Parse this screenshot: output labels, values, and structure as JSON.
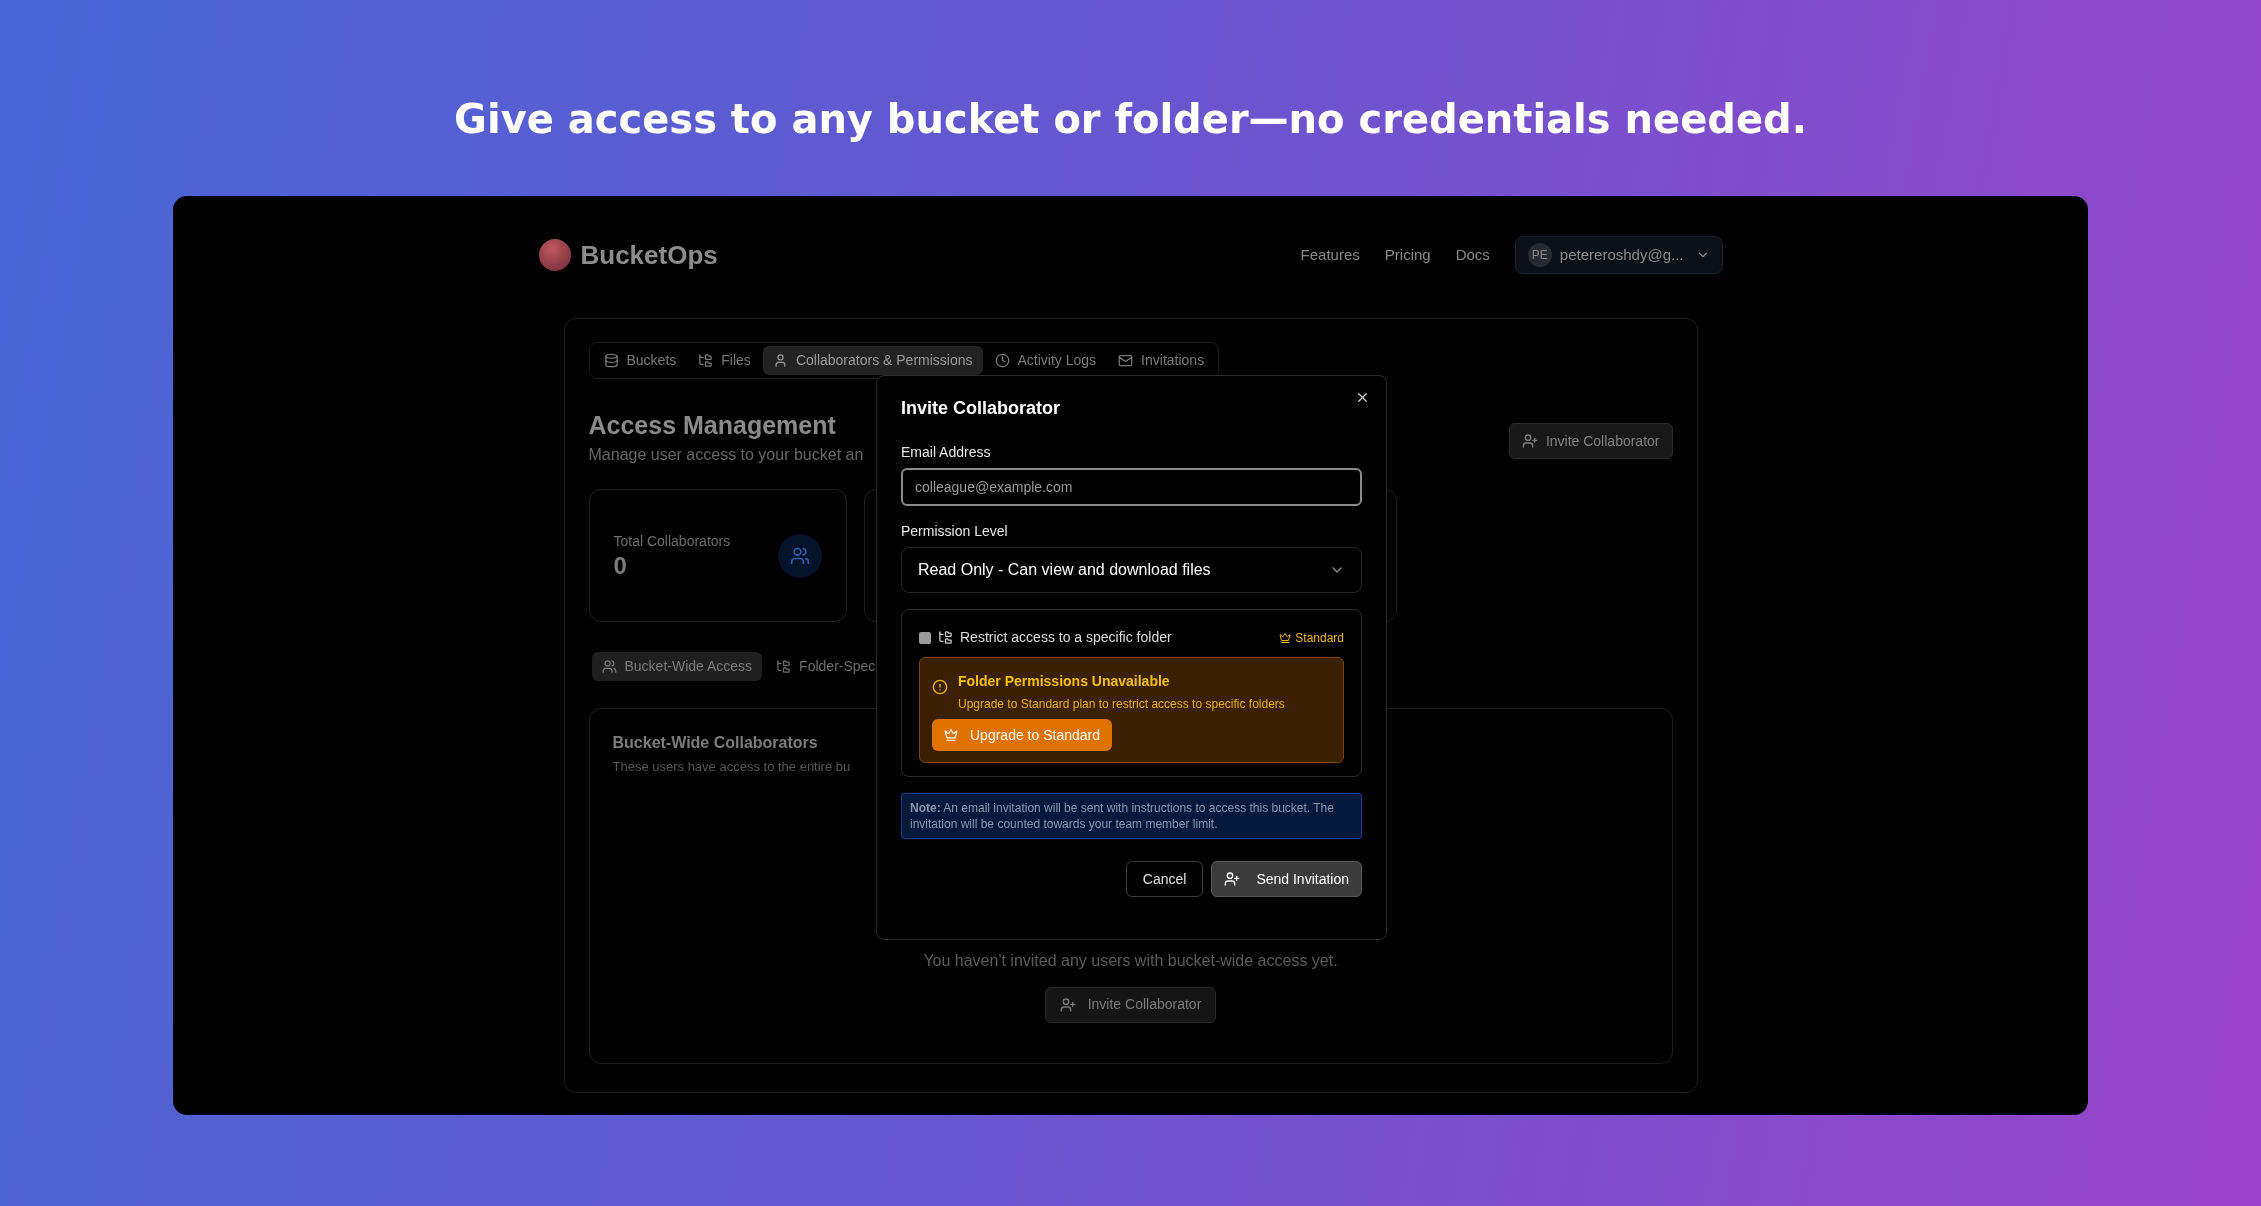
{
  "headline": "Give access to any bucket or folder—no credentials needed.",
  "brand": "BucketOps",
  "nav": [
    "Features",
    "Pricing",
    "Docs"
  ],
  "user": {
    "initials": "PE",
    "email": "petereroshdy@g..."
  },
  "tabs": [
    {
      "label": "Buckets",
      "selected": false
    },
    {
      "label": "Files",
      "selected": false
    },
    {
      "label": "Collaborators & Permissions",
      "selected": true
    },
    {
      "label": "Activity Logs",
      "selected": false
    },
    {
      "label": "Invitations",
      "selected": false
    }
  ],
  "page": {
    "title": "Access Management",
    "subtitle": "Manage user access to your bucket an",
    "invite_button": "Invite Collaborator"
  },
  "stats": [
    {
      "label": "Total Collaborators",
      "value": "0"
    }
  ],
  "access_tabs": [
    {
      "label": "Bucket-Wide Access",
      "selected": true
    },
    {
      "label": "Folder-Spec",
      "selected": false
    }
  ],
  "section": {
    "title": "Bucket-Wide Collaborators",
    "subtitle": "These users have access to the entire bu",
    "empty_text": "You haven't invited any users with bucket-wide access yet.",
    "invite_button": "Invite Collaborator"
  },
  "dialog": {
    "title": "Invite Collaborator",
    "email": {
      "label": "Email Address",
      "placeholder": "colleague@example.com"
    },
    "permission": {
      "label": "Permission Level",
      "value": "Read Only - Can view and download files"
    },
    "restrict": {
      "checked": false,
      "label": "Restrict access to a specific folder",
      "badge": "Standard"
    },
    "warning": {
      "title": "Folder Permissions Unavailable",
      "text": "Upgrade to Standard plan to restrict access to specific folders",
      "button": "Upgrade to Standard"
    },
    "note": "**Note:** An email invitation will be sent with instructions to access this bucket. The invitation will be counted towards your team member limit.",
    "cancel": "Cancel",
    "send": "Send Invitation"
  }
}
